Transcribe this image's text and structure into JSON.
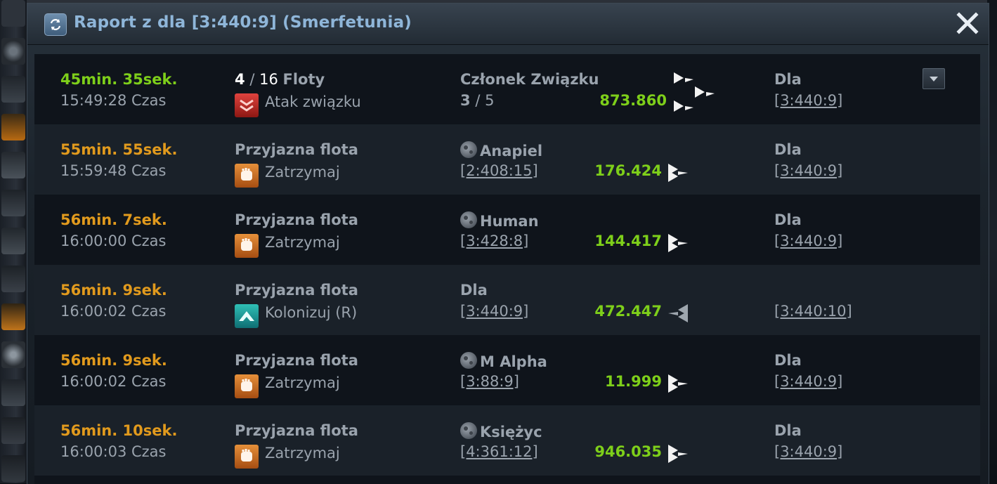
{
  "window": {
    "title": "Raport z dla [3:440:9] (Smerfetunia)"
  },
  "rows": [
    {
      "countdown": "45min. 35sek.",
      "countdown_color": "green",
      "arrival": "15:49:28 Czas",
      "fleet_current": "4",
      "fleet_sep": "/",
      "fleet_total": "16",
      "fleet_word": "Floty",
      "mission": "Atak związku",
      "mission_icon": "alliance-attack-icon",
      "origin_name": "Członek Związku",
      "origin_sub_a": "3",
      "origin_sub_sep": "/",
      "origin_sub_b": "5",
      "ships": "873.860",
      "dest_label": "Dla",
      "dest_coords": "[3:440:9]"
    },
    {
      "countdown": "55min. 55sek.",
      "countdown_color": "orange",
      "arrival": "15:59:48 Czas",
      "fleet_label": "Przyjazna flota",
      "mission": "Zatrzymaj",
      "mission_icon": "hold-fist-icon",
      "origin_name": "Anapiel",
      "origin_coords": "[2:408:15]",
      "ships": "176.424",
      "dest_label": "Dla",
      "dest_coords": "[3:440:9]"
    },
    {
      "countdown": "56min. 7sek.",
      "countdown_color": "orange",
      "arrival": "16:00:00 Czas",
      "fleet_label": "Przyjazna flota",
      "mission": "Zatrzymaj",
      "mission_icon": "hold-fist-icon",
      "origin_name": "Human",
      "origin_coords": "[3:428:8]",
      "ships": "144.417",
      "dest_label": "Dla",
      "dest_coords": "[3:440:9]"
    },
    {
      "countdown": "56min. 9sek.",
      "countdown_color": "orange",
      "arrival": "16:00:02 Czas",
      "fleet_label": "Przyjazna flota",
      "mission": "Kolonizuj (R)",
      "mission_icon": "colonize-icon",
      "origin_name": "Dla",
      "origin_coords": "[3:440:9]",
      "ships": "472.447",
      "dest_label": "",
      "dest_coords": "[3:440:10]"
    },
    {
      "countdown": "56min. 9sek.",
      "countdown_color": "orange",
      "arrival": "16:00:02 Czas",
      "fleet_label": "Przyjazna flota",
      "mission": "Zatrzymaj",
      "mission_icon": "hold-fist-icon",
      "origin_name": "M Alpha",
      "origin_coords": "[3:88:9]",
      "ships": "11.999",
      "dest_label": "Dla",
      "dest_coords": "[3:440:9]"
    },
    {
      "countdown": "56min. 10sek.",
      "countdown_color": "orange",
      "arrival": "16:00:03 Czas",
      "fleet_label": "Przyjazna flota",
      "mission": "Zatrzymaj",
      "mission_icon": "hold-fist-icon",
      "origin_name": "Księżyc",
      "origin_coords": "[4:361:12]",
      "ships": "946.035",
      "dest_label": "Dla",
      "dest_coords": "[3:440:9]"
    }
  ],
  "colors": {
    "green": "#7ecf1a",
    "orange": "#e19a1d",
    "title": "#8fb6d9"
  }
}
